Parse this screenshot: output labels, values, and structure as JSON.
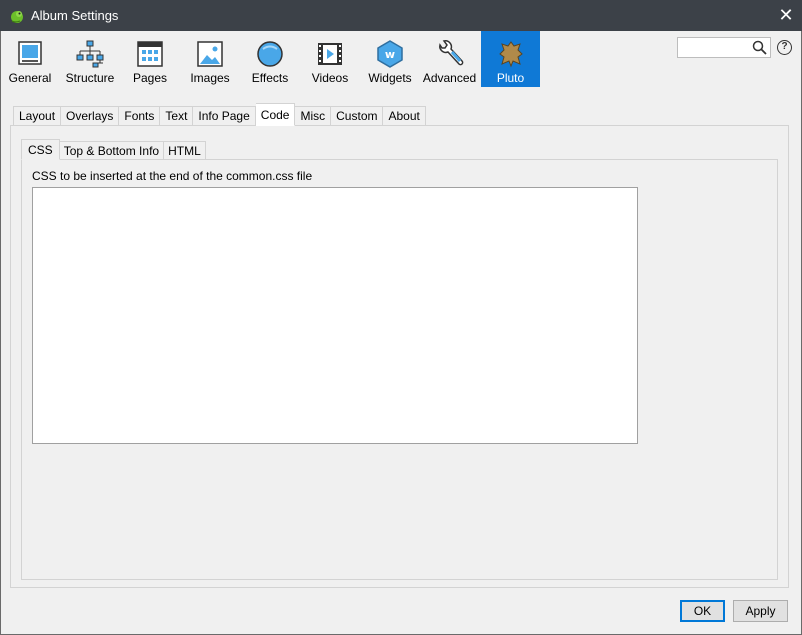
{
  "window": {
    "title": "Album Settings",
    "close_glyph": "✕"
  },
  "toolbar": {
    "items": [
      {
        "label": "General",
        "icon": "general-icon"
      },
      {
        "label": "Structure",
        "icon": "structure-icon"
      },
      {
        "label": "Pages",
        "icon": "pages-icon"
      },
      {
        "label": "Images",
        "icon": "images-icon"
      },
      {
        "label": "Effects",
        "icon": "effects-icon"
      },
      {
        "label": "Videos",
        "icon": "videos-icon"
      },
      {
        "label": "Widgets",
        "icon": "widgets-icon"
      },
      {
        "label": "Advanced",
        "icon": "advanced-icon"
      },
      {
        "label": "Pluto",
        "icon": "pluto-icon",
        "active": true
      }
    ],
    "active_color": "#0f79d6",
    "search": {
      "value": "",
      "placeholder": ""
    },
    "help_glyph": "?"
  },
  "outer_tabs": {
    "items": [
      "Layout",
      "Overlays",
      "Fonts",
      "Text",
      "Info Page",
      "Code",
      "Misc",
      "Custom",
      "About"
    ],
    "active": "Code"
  },
  "inner_tabs": {
    "items": [
      "CSS",
      "Top & Bottom Info",
      "HTML"
    ],
    "active": "CSS"
  },
  "css_section": {
    "label": "CSS to be inserted at the end of the common.css file",
    "value": ""
  },
  "buttons": {
    "ok": "OK",
    "apply": "Apply"
  }
}
